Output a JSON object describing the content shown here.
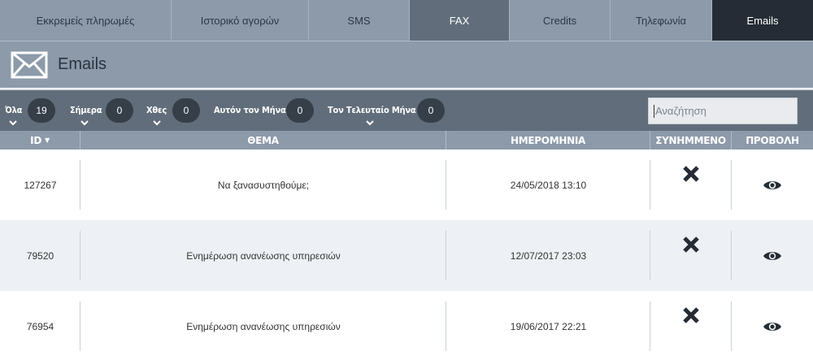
{
  "tabs": [
    {
      "label": "Εκκρεμείς πληρωμές"
    },
    {
      "label": "Ιστορικό αγορών"
    },
    {
      "label": "SMS"
    },
    {
      "label": "FAX"
    },
    {
      "label": "Credits"
    },
    {
      "label": "Τηλεφωνία"
    },
    {
      "label": "Emails"
    }
  ],
  "page": {
    "title": "Emails",
    "icon": "envelope-icon"
  },
  "filters": [
    {
      "label": "Όλα",
      "count": "19"
    },
    {
      "label": "Σήμερα",
      "count": "0"
    },
    {
      "label": "Χθες",
      "count": "0"
    },
    {
      "label": "Αυτόν τον Μήνα",
      "count": "0"
    },
    {
      "label": "Τον Τελευταίο Μήνα",
      "count": "0"
    }
  ],
  "search": {
    "placeholder": "Αναζήτηση"
  },
  "table": {
    "headers": {
      "id": "ID",
      "subject": "ΘΕΜΑ",
      "date": "ΗΜΕΡΟΜΗΝΙΑ",
      "attachment": "ΣΥΝΗΜΜΕΝΟ",
      "view": "ΠΡΟΒΟΛΗ"
    },
    "sort_indicator": "▼",
    "rows": [
      {
        "id": "127267",
        "subject": "Να ξανασυστηθούμε;",
        "date": "24/05/2018 13:10",
        "attachment_icon": "x-icon",
        "view_icon": "eye-icon"
      },
      {
        "id": "79520",
        "subject": "Ενημέρωση ανανέωσης υπηρεσιών",
        "date": "12/07/2017 23:03",
        "attachment_icon": "x-icon",
        "view_icon": "eye-icon"
      },
      {
        "id": "76954",
        "subject": "Ενημέρωση ανανέωσης υπηρεσιών",
        "date": "19/06/2017 22:21",
        "attachment_icon": "x-icon",
        "view_icon": "eye-icon"
      }
    ]
  },
  "colors": {
    "tab_bg": "#8c9aaa",
    "tab_fax_bg": "#616d7a",
    "tab_active_bg": "#262c35",
    "filter_bar_bg": "#616d7a",
    "badge_bg": "#363e48",
    "row_alt_bg": "#edf1f5"
  }
}
